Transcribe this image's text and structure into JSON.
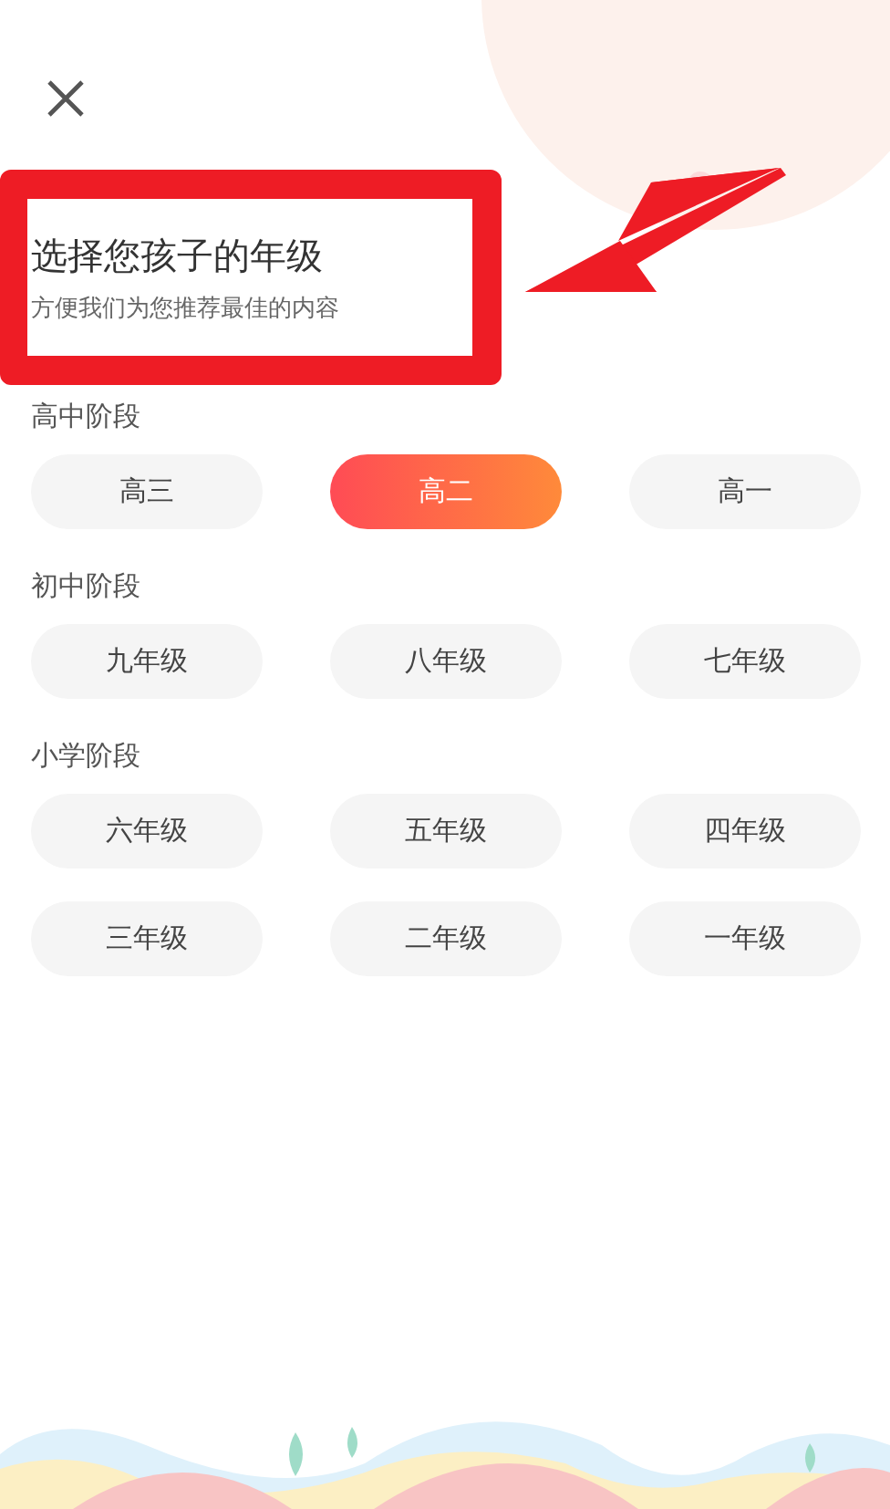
{
  "header": {
    "title": "选择您孩子的年级",
    "subtitle": "方便我们为您推荐最佳的内容"
  },
  "sections": [
    {
      "label": "高中阶段",
      "grades": [
        {
          "label": "高三",
          "selected": false
        },
        {
          "label": "高二",
          "selected": true
        },
        {
          "label": "高一",
          "selected": false
        }
      ]
    },
    {
      "label": "初中阶段",
      "grades": [
        {
          "label": "九年级",
          "selected": false
        },
        {
          "label": "八年级",
          "selected": false
        },
        {
          "label": "七年级",
          "selected": false
        }
      ]
    },
    {
      "label": "小学阶段",
      "grades": [
        {
          "label": "六年级",
          "selected": false
        },
        {
          "label": "五年级",
          "selected": false
        },
        {
          "label": "四年级",
          "selected": false
        },
        {
          "label": "三年级",
          "selected": false
        },
        {
          "label": "二年级",
          "selected": false
        },
        {
          "label": "一年级",
          "selected": false
        }
      ]
    }
  ]
}
